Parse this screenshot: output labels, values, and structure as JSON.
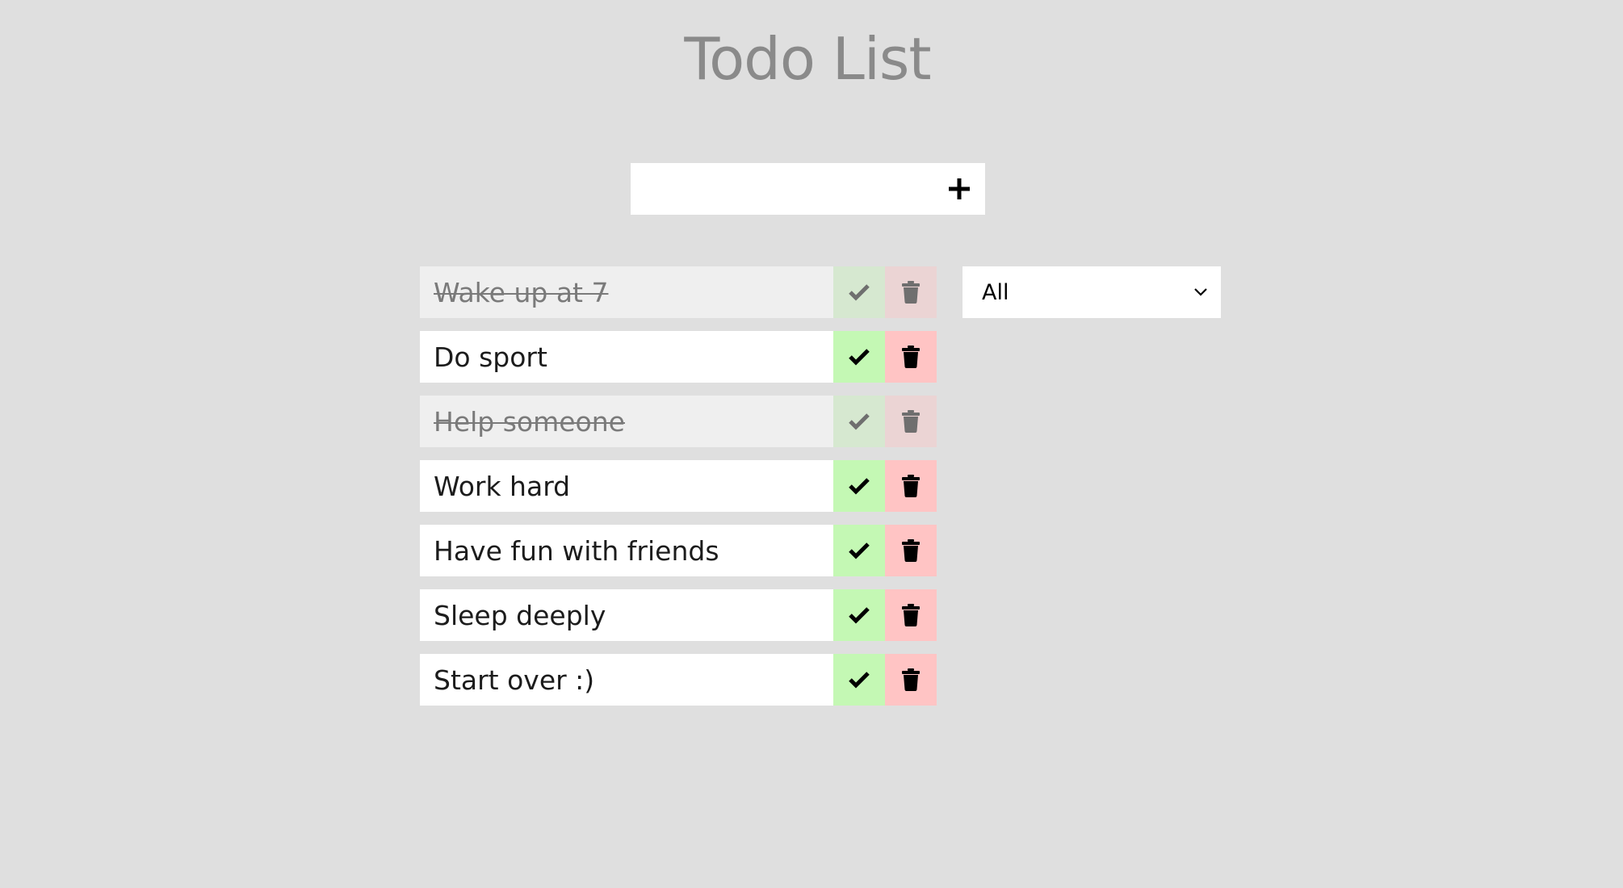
{
  "header": {
    "title": "Todo List"
  },
  "add_form": {
    "input_value": "",
    "add_icon": "plus-icon"
  },
  "filter": {
    "selected": "All",
    "icon": "chevron-down-icon"
  },
  "todos": [
    {
      "text": "Wake up at 7",
      "completed": true
    },
    {
      "text": "Do sport",
      "completed": false
    },
    {
      "text": "Help someone",
      "completed": true
    },
    {
      "text": "Work hard",
      "completed": false
    },
    {
      "text": "Have fun with friends",
      "completed": false
    },
    {
      "text": "Sleep deeply",
      "completed": false
    },
    {
      "text": "Start over :)",
      "completed": false
    }
  ],
  "icons": {
    "complete": "check-icon",
    "delete": "trash-icon"
  },
  "colors": {
    "background": "#dfdfdf",
    "title": "#8a8a8a",
    "complete_button": "#c4f8b4",
    "delete_button": "#ffc4c4",
    "completed_text": "#7a7a7a"
  }
}
